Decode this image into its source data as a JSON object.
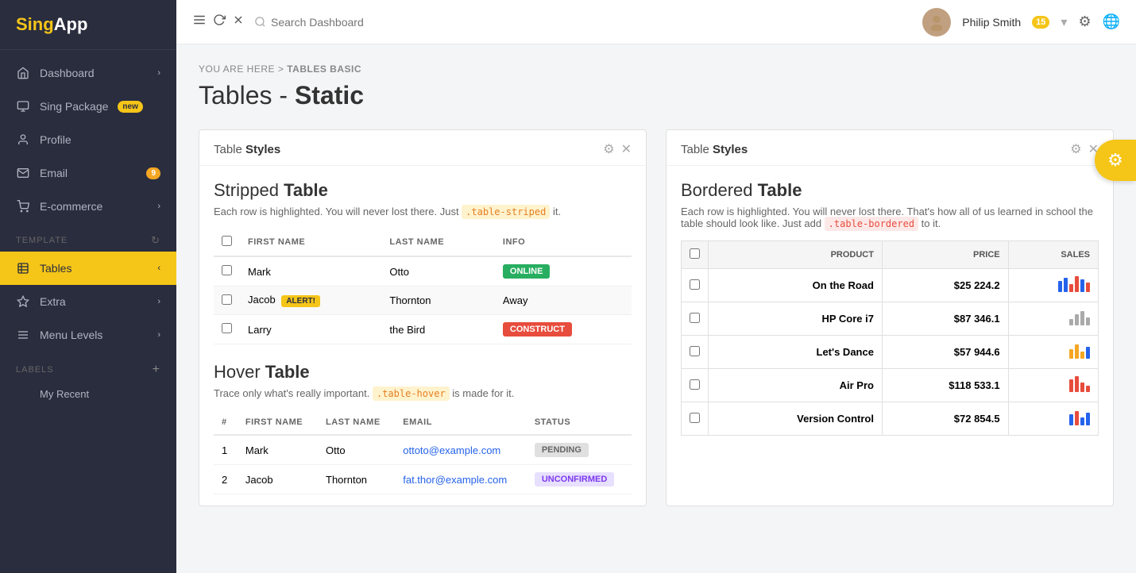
{
  "app": {
    "name_part1": "Sing",
    "name_part2": "App"
  },
  "sidebar": {
    "nav_items": [
      {
        "id": "dashboard",
        "label": "Dashboard",
        "icon": "home",
        "badge": null,
        "chevron": true
      },
      {
        "id": "sing-package",
        "label": "Sing Package",
        "icon": "box",
        "badge": "new",
        "chevron": false
      },
      {
        "id": "profile",
        "label": "Profile",
        "icon": "user",
        "badge": null,
        "chevron": false
      },
      {
        "id": "email",
        "label": "Email",
        "icon": "mail",
        "badge": "9",
        "badge_color": "orange",
        "chevron": false
      },
      {
        "id": "ecommerce",
        "label": "E-commerce",
        "icon": "shop",
        "badge": null,
        "chevron": true
      }
    ],
    "template_label": "TEMPLATE",
    "template_items": [
      {
        "id": "tables",
        "label": "Tables",
        "icon": "table",
        "active": true,
        "chevron": true
      },
      {
        "id": "extra",
        "label": "Extra",
        "icon": "star",
        "chevron": true
      },
      {
        "id": "menu-levels",
        "label": "Menu Levels",
        "icon": "menu",
        "chevron": true
      }
    ],
    "labels_label": "LABELS",
    "labels_items": [
      {
        "id": "my-recent",
        "label": "My Recent"
      }
    ]
  },
  "topbar": {
    "search_placeholder": "Search Dashboard",
    "user_name": "Philip Smith",
    "user_badge": "15",
    "icons": [
      "hamburger",
      "refresh",
      "close"
    ]
  },
  "breadcrumb": {
    "prefix": "YOU ARE HERE >",
    "current": "Tables Basic"
  },
  "page_title": {
    "prefix": "Tables - ",
    "bold": "Static"
  },
  "left_card": {
    "header_label": "Table",
    "header_bold": "Styles",
    "stripped_section": {
      "title_normal": "Stripped ",
      "title_bold": "Table",
      "description_prefix": "Each row is highlighted. You will never lost there. Just ",
      "code_tag": ".table-striped",
      "description_suffix": " it.",
      "columns": [
        "",
        "FIRST NAME",
        "LAST NAME",
        "INFO"
      ],
      "rows": [
        {
          "first": "Mark",
          "last": "Otto",
          "info": "Online",
          "info_type": "badge-green",
          "alert": null
        },
        {
          "first": "Jacob",
          "last": "Thornton",
          "info": "Away",
          "info_type": "text",
          "alert": "ALERT!"
        },
        {
          "first": "Larry",
          "last": "the Bird",
          "info": "Construct",
          "info_type": "badge-pink",
          "alert": null
        }
      ]
    },
    "hover_section": {
      "title_normal": "Hover ",
      "title_bold": "Table",
      "description_prefix": "Trace only what's really important. ",
      "code_tag": ".table-hover",
      "description_suffix": " is made for it.",
      "columns": [
        "#",
        "FIRST NAME",
        "LAST NAME",
        "EMAIL",
        "STATUS"
      ],
      "rows": [
        {
          "num": 1,
          "first": "Mark",
          "last": "Otto",
          "email": "ottoto@example.com",
          "status": "Pending",
          "status_type": "badge-gray"
        },
        {
          "num": 2,
          "first": "Jacob",
          "last": "Thornton",
          "email": "fat.thor@example.com",
          "status": "Unconfirmed",
          "status_type": "badge-gray-outline"
        }
      ]
    }
  },
  "right_card": {
    "header_label": "Table",
    "header_bold": "Styles",
    "bordered_section": {
      "title_normal": "Bordered ",
      "title_bold": "Table",
      "description_prefix": "Each row is highlighted. You will never lost there. That's how all of us learned in school the table should look like. Just add ",
      "code_tag": ".table-bordered",
      "description_suffix": " to it.",
      "columns": [
        "",
        "PRODUCT",
        "PRICE",
        "SALES"
      ],
      "rows": [
        {
          "product": "On the Road",
          "price": "$25 224.2",
          "bars": [
            {
              "h": 14,
              "c": "#2563eb"
            },
            {
              "h": 18,
              "c": "#2563eb"
            },
            {
              "h": 10,
              "c": "#e74c3c"
            },
            {
              "h": 20,
              "c": "#e74c3c"
            },
            {
              "h": 16,
              "c": "#2563eb"
            },
            {
              "h": 12,
              "c": "#e74c3c"
            }
          ]
        },
        {
          "product": "HP Core i7",
          "price": "$87 346.1",
          "bars": [
            {
              "h": 8,
              "c": "#aaa"
            },
            {
              "h": 14,
              "c": "#aaa"
            },
            {
              "h": 18,
              "c": "#aaa"
            },
            {
              "h": 10,
              "c": "#aaa"
            }
          ]
        },
        {
          "product": "Let's Dance",
          "price": "$57 944.6",
          "bars": [
            {
              "h": 12,
              "c": "#f5a623"
            },
            {
              "h": 18,
              "c": "#f5a623"
            },
            {
              "h": 9,
              "c": "#f5a623"
            },
            {
              "h": 15,
              "c": "#2563eb"
            }
          ]
        },
        {
          "product": "Air Pro",
          "price": "$118 533.1",
          "bars": [
            {
              "h": 16,
              "c": "#e74c3c"
            },
            {
              "h": 20,
              "c": "#e74c3c"
            },
            {
              "h": 12,
              "c": "#e74c3c"
            },
            {
              "h": 8,
              "c": "#e74c3c"
            }
          ]
        },
        {
          "product": "Version Control",
          "price": "$72 854.5",
          "bars": [
            {
              "h": 14,
              "c": "#2563eb"
            },
            {
              "h": 18,
              "c": "#e74c3c"
            },
            {
              "h": 10,
              "c": "#2563eb"
            },
            {
              "h": 16,
              "c": "#2563eb"
            }
          ]
        }
      ]
    }
  },
  "floating_gear": {
    "icon": "⚙"
  }
}
